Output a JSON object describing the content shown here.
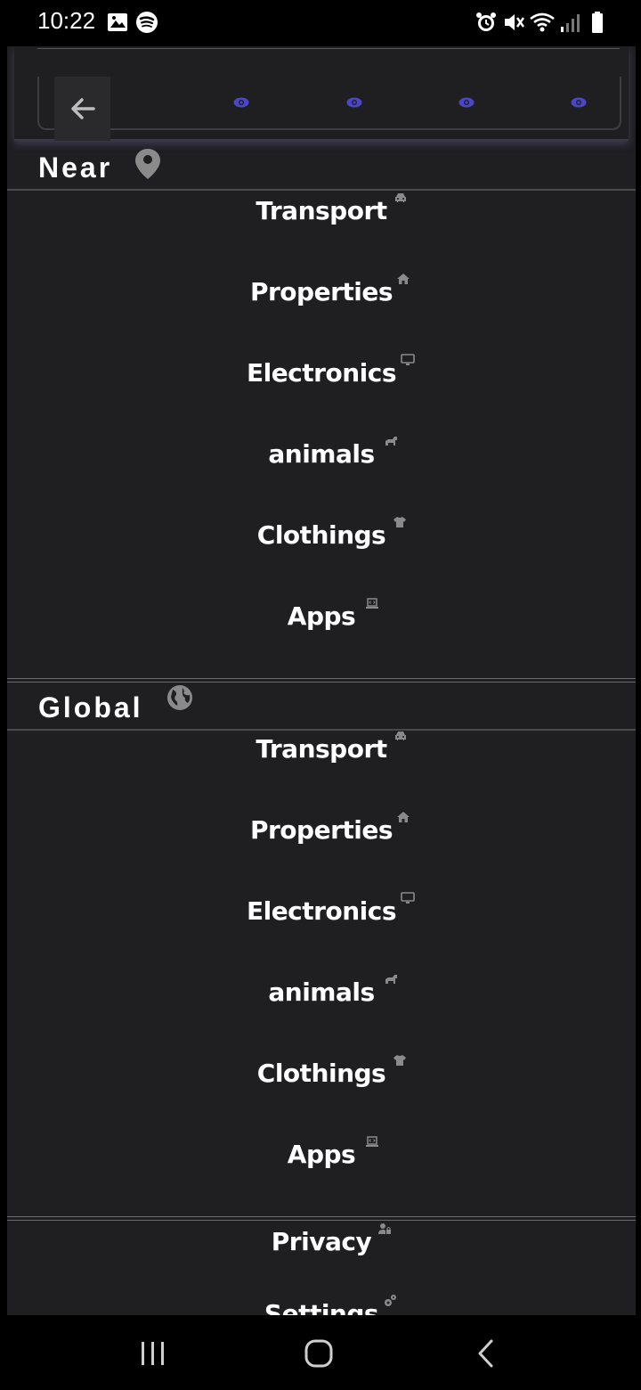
{
  "status_bar": {
    "time": "10:22",
    "left_icons": [
      "image-icon",
      "spotify-icon"
    ],
    "right_icons": [
      "alarm-icon",
      "mute-icon",
      "wifi-icon",
      "signal-icon",
      "battery-icon"
    ]
  },
  "top_bar": {
    "back_icon": "arrow-left-icon",
    "eye_icons": [
      "eye-icon",
      "eye-icon",
      "eye-icon",
      "eye-icon"
    ]
  },
  "near": {
    "title": "Near",
    "icon": "location-pin-icon",
    "items": [
      {
        "label": "Transport",
        "icon": "car-icon"
      },
      {
        "label": "Properties",
        "icon": "home-icon"
      },
      {
        "label": "Electronics",
        "icon": "desktop-icon"
      },
      {
        "label": "animals",
        "icon": "dog-icon"
      },
      {
        "label": "Clothings",
        "icon": "shirt-icon"
      },
      {
        "label": "Apps",
        "icon": "laptop-code-icon"
      }
    ]
  },
  "global": {
    "title": "Global",
    "icon": "globe-icon",
    "items": [
      {
        "label": "Transport",
        "icon": "car-icon"
      },
      {
        "label": "Properties",
        "icon": "home-icon"
      },
      {
        "label": "Electronics",
        "icon": "desktop-icon"
      },
      {
        "label": "animals",
        "icon": "dog-icon"
      },
      {
        "label": "Clothings",
        "icon": "shirt-icon"
      },
      {
        "label": "Apps",
        "icon": "laptop-code-icon"
      }
    ]
  },
  "extra": {
    "items": [
      {
        "label": "Privacy",
        "icon": "user-lock-icon"
      },
      {
        "label": "Settings",
        "icon": "gears-icon"
      }
    ]
  },
  "colors": {
    "drawer_bg": "#1f1f22",
    "eye_accent": "#4b46c8",
    "icon_gray": "#8a8a8a"
  }
}
